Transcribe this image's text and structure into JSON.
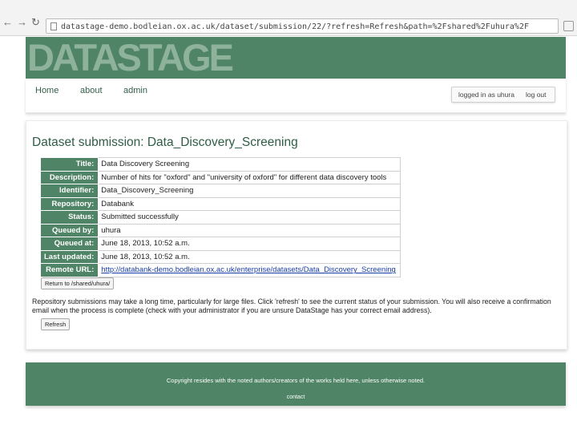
{
  "browser": {
    "back_glyph": "←",
    "forward_glyph": "→",
    "reload_glyph": "↻",
    "url": "datastage-demo.bodleian.ox.ac.uk/dataset/submission/22/?refresh=Refresh&path=%2Fshared%2Fuhura%2F"
  },
  "header": {
    "logo_text": "DATASTAGE",
    "brand_color": "#4f8466"
  },
  "menu": {
    "items": [
      {
        "label": "Home"
      },
      {
        "label": "about"
      },
      {
        "label": "admin"
      }
    ],
    "logged_in_text": "logged in as uhura",
    "logout_label": "log out"
  },
  "main": {
    "title": "Dataset submission: Data_Discovery_Screening",
    "rows": [
      {
        "label": "Title:",
        "value": "Data Discovery Screening"
      },
      {
        "label": "Description:",
        "value": "Number of hits for \"oxford\" and \"university of oxford\" for different data discovery tools"
      },
      {
        "label": "Identifier:",
        "value": "Data_Discovery_Screening"
      },
      {
        "label": "Repository:",
        "value": "Databank"
      },
      {
        "label": "Status:",
        "value": "Submitted successfully"
      },
      {
        "label": "Queued by:",
        "value": "uhura"
      },
      {
        "label": "Queued at:",
        "value": "June 18, 2013, 10:52 a.m."
      },
      {
        "label": "Last updated:",
        "value": "June 18, 2013, 10:52 a.m."
      },
      {
        "label": "Remote URL:",
        "value": "http://databank-demo.bodleian.ox.ac.uk/enterprise/datasets/Data_Discovery_Screening"
      }
    ],
    "return_button": "Return to /shared/uhura/",
    "note": "Repository submissions may take a long time, particularly for large files. Click 'refresh' to see the current status of your submission. You will also receive a confirmation email when the process is complete (check with your administrator if you are unsure DataStage has your correct email address).",
    "refresh_button": "Refresh"
  },
  "footer": {
    "copyright": "Copyright resides with the noted authors/creators of the works held here, unless otherwise noted.",
    "contact": "contact"
  }
}
